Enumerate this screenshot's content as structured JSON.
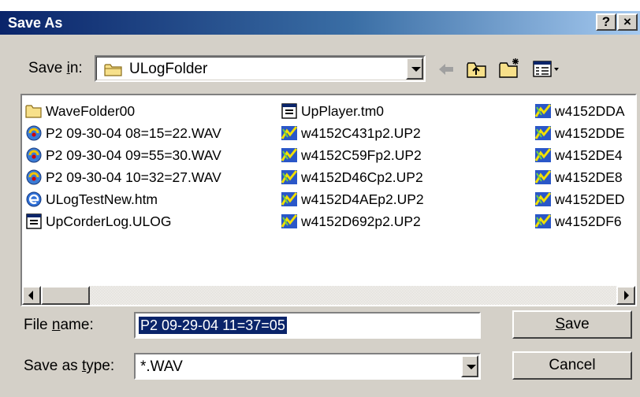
{
  "window": {
    "title": "Save As",
    "help_label": "?",
    "close_label": "×"
  },
  "toolbar": {
    "save_in_prefix": "Save ",
    "save_in_underlined": "i",
    "save_in_suffix": "n:",
    "current_folder": "ULogFolder"
  },
  "files": {
    "columns": [
      [
        {
          "name": "WaveFolder00",
          "icon": "folder-icon"
        },
        {
          "name": "P2 09-30-04 08=15=22.WAV",
          "icon": "audio-file-icon"
        },
        {
          "name": "P2 09-30-04 09=55=30.WAV",
          "icon": "audio-file-icon"
        },
        {
          "name": "P2 09-30-04 10=32=27.WAV",
          "icon": "audio-file-icon"
        },
        {
          "name": "ULogTestNew.htm",
          "icon": "html-file-icon"
        },
        {
          "name": "UpCorderLog.ULOG",
          "icon": "application-file-icon"
        }
      ],
      [
        {
          "name": "UpPlayer.tm0",
          "icon": "application-file-icon"
        },
        {
          "name": "w4152C431p2.UP2",
          "icon": "up2-file-icon"
        },
        {
          "name": "w4152C59Fp2.UP2",
          "icon": "up2-file-icon"
        },
        {
          "name": "w4152D46Cp2.UP2",
          "icon": "up2-file-icon"
        },
        {
          "name": "w4152D4AEp2.UP2",
          "icon": "up2-file-icon"
        },
        {
          "name": "w4152D692p2.UP2",
          "icon": "up2-file-icon"
        }
      ],
      [
        {
          "name": "w4152DDA",
          "icon": "up2-file-icon"
        },
        {
          "name": "w4152DDE",
          "icon": "up2-file-icon"
        },
        {
          "name": "w4152DE4",
          "icon": "up2-file-icon"
        },
        {
          "name": "w4152DE8",
          "icon": "up2-file-icon"
        },
        {
          "name": "w4152DED",
          "icon": "up2-file-icon"
        },
        {
          "name": "w4152DF6",
          "icon": "up2-file-icon"
        }
      ]
    ]
  },
  "form": {
    "file_name_prefix": "File ",
    "file_name_underlined": "n",
    "file_name_suffix": "ame:",
    "file_name_value": "P2 09-29-04 11=37=05",
    "type_prefix": "Save as ",
    "type_underlined": "t",
    "type_suffix": "ype:",
    "type_value": "*.WAV"
  },
  "buttons": {
    "save_underlined": "S",
    "save_rest": "ave",
    "cancel_label": "Cancel"
  },
  "colors": {
    "title_start": "#0a246a",
    "title_end": "#a6caf0",
    "face": "#d4d0c8",
    "selection": "#0a246a"
  }
}
